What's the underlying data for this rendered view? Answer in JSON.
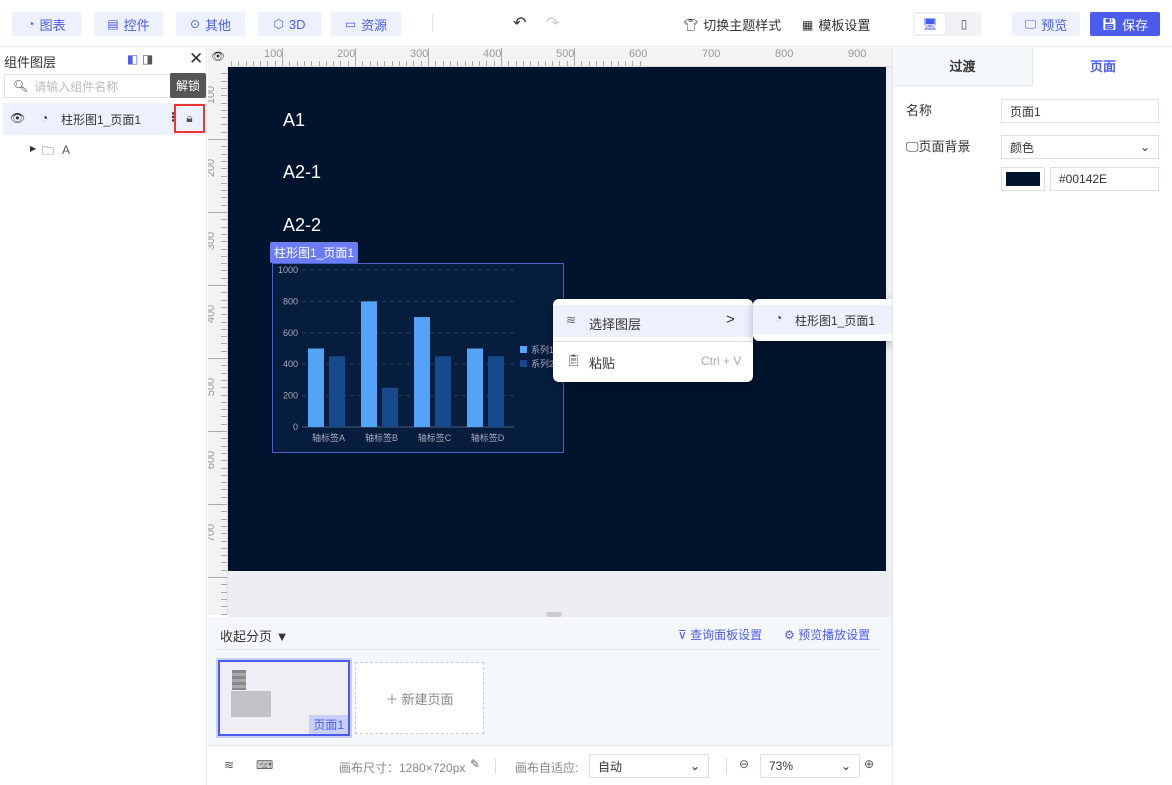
{
  "toolbar": {
    "chart": "图表",
    "control": "控件",
    "other": "其他",
    "three_d": "3D",
    "resource": "资源",
    "theme": "切换主题样式",
    "template": "模板设置",
    "preview": "预览",
    "save": "保存"
  },
  "layers": {
    "title": "组件图层",
    "search_placeholder": "请输入组件名称",
    "item": "柱形图1_页面1",
    "folder": "A",
    "tooltip": "解锁"
  },
  "ruler": {
    "top": [
      "100",
      "200",
      "300",
      "400",
      "500",
      "600",
      "700",
      "800",
      "900"
    ],
    "left": [
      "100",
      "200",
      "300",
      "400",
      "500",
      "600",
      "700"
    ]
  },
  "canvas": {
    "bg": "#00142E",
    "texts": [
      "A1",
      "A2-1",
      "A2-2"
    ],
    "selected_label": "柱形图1_页面1"
  },
  "chart_data": {
    "type": "bar",
    "categories": [
      "轴标签A",
      "轴标签B",
      "轴标签C",
      "轴标签D"
    ],
    "series": [
      {
        "name": "系列1",
        "values": [
          500,
          800,
          700,
          500
        ],
        "color": "#54a3f6"
      },
      {
        "name": "系列2",
        "values": [
          450,
          250,
          450,
          450
        ],
        "color": "#164a8c"
      }
    ],
    "ylim": [
      0,
      1000
    ],
    "yticks": [
      "0",
      "200",
      "400",
      "600",
      "800",
      "1000"
    ],
    "grid": true,
    "legend": "right"
  },
  "context_menu": {
    "select_layer": "选择图层",
    "paste": "粘贴",
    "paste_shortcut": "Ctrl + V",
    "submenu_item": "柱形图1_页面1",
    "tooltip": "解锁"
  },
  "pages": {
    "collapse": "收起分页",
    "query_settings": "查询面板设置",
    "preview_settings": "预览播放设置",
    "page1": "页面1",
    "new_page": "新建页面"
  },
  "bottom": {
    "canvas_size": "画布尺寸：1280×720px",
    "adapt_label": "画布自适应:",
    "adapt_value": "自动",
    "zoom": "73%"
  },
  "right": {
    "tab_transition": "过渡",
    "tab_page": "页面",
    "name_label": "名称",
    "name_value": "页面1",
    "bg_label": "页面背景",
    "bg_type": "颜色",
    "bg_color": "#00142E"
  }
}
